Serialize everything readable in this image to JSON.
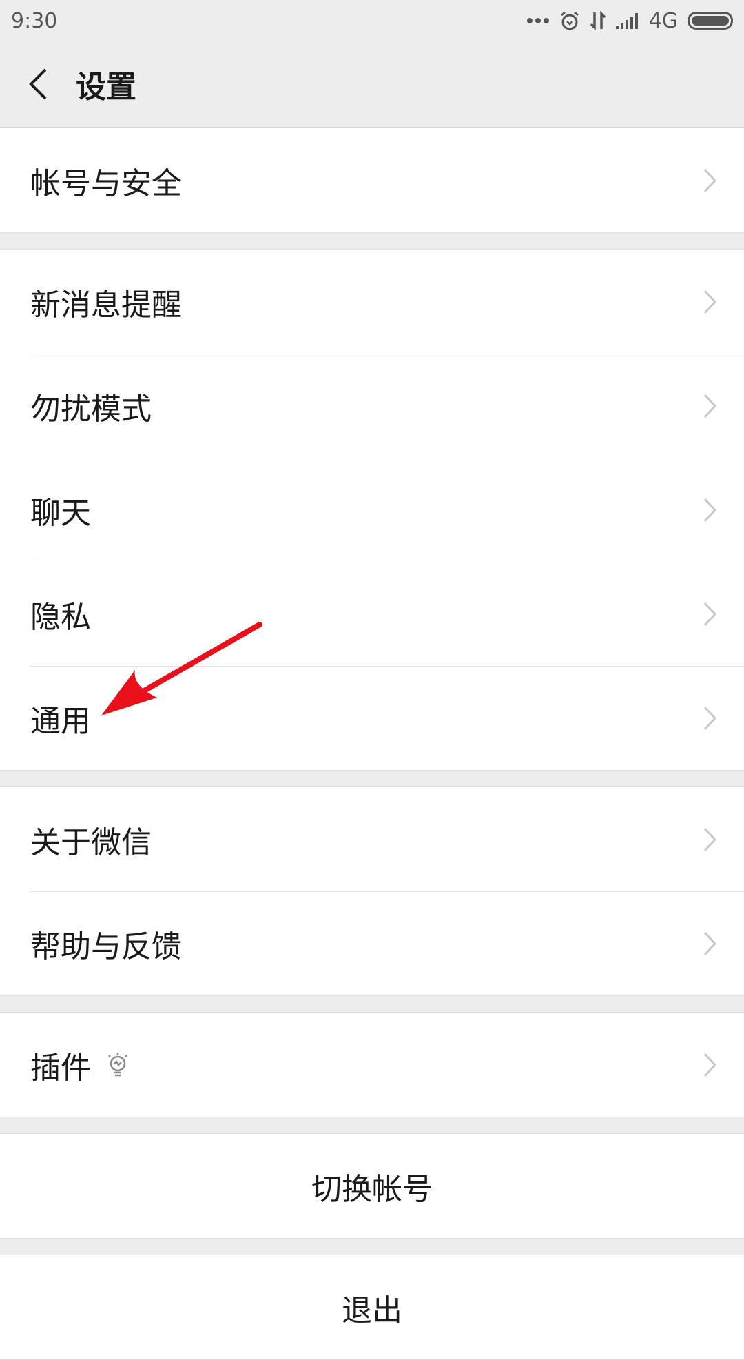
{
  "status_bar": {
    "time": "9:30",
    "network": "4G",
    "icons": [
      "more-dots-icon",
      "alarm-icon",
      "data-transfer-icon",
      "signal-icon",
      "battery-icon"
    ]
  },
  "header": {
    "title": "设置",
    "back_icon": "chevron-left-icon"
  },
  "groups": [
    {
      "items": [
        {
          "label": "帐号与安全"
        }
      ]
    },
    {
      "items": [
        {
          "label": "新消息提醒"
        },
        {
          "label": "勿扰模式"
        },
        {
          "label": "聊天"
        },
        {
          "label": "隐私"
        },
        {
          "label": "通用"
        }
      ]
    },
    {
      "items": [
        {
          "label": "关于微信"
        },
        {
          "label": "帮助与反馈"
        }
      ]
    },
    {
      "items": [
        {
          "label": "插件",
          "icon": "lightbulb-icon"
        }
      ]
    }
  ],
  "actions": {
    "switch_account": "切换帐号",
    "logout": "退出"
  },
  "annotation": {
    "color": "#e8101a",
    "points_to": "通用"
  }
}
